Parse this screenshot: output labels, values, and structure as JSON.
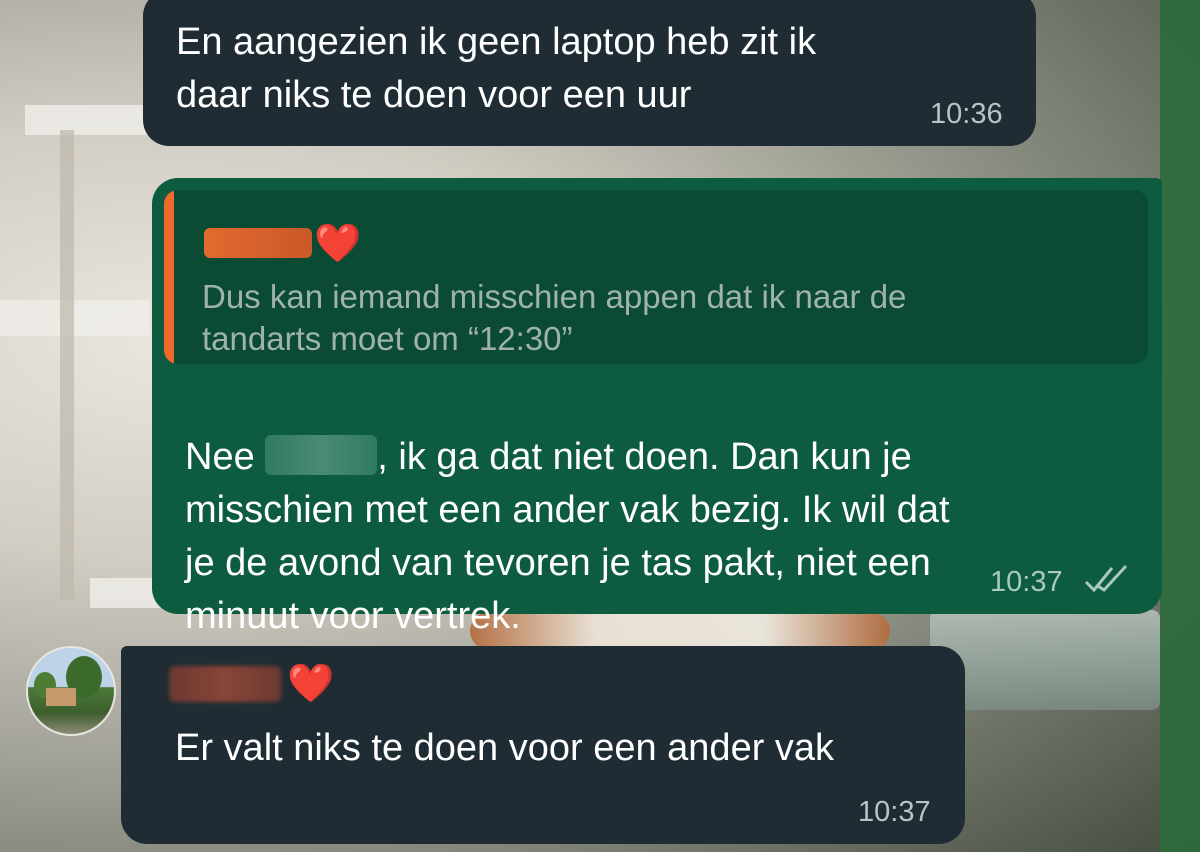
{
  "messages": [
    {
      "direction": "incoming",
      "text": "En aangezien ik geen laptop heb zit ik\ndaar niks te doen voor een uur",
      "time": "10:36"
    },
    {
      "direction": "outgoing",
      "quote": {
        "sender_suffix": "❤️",
        "text": "Dus kan iemand misschien appen dat ik naar de\ntandarts moet om “12:30”",
        "accent_color": "#f06a2c"
      },
      "text_before_redaction": "Nee ",
      "text_after_redaction": ", ik ga dat niet doen. Dan kun je",
      "text_rest": "misschien met een ander vak bezig. Ik wil dat\nje de avond van tevoren je tas pakt, niet een\nminuut voor vertrek.",
      "time": "10:37",
      "status": "read",
      "status_icon": "double-check-icon"
    },
    {
      "direction": "incoming",
      "sender_suffix": "❤️",
      "text": "Er valt niks te doen voor een ander vak",
      "time": "10:37"
    }
  ],
  "colors": {
    "incoming_bubble": "#1f2c34",
    "outgoing_bubble": "#0d5c3f",
    "quote_background": "#0b4a33",
    "heart": "#e8202a"
  }
}
